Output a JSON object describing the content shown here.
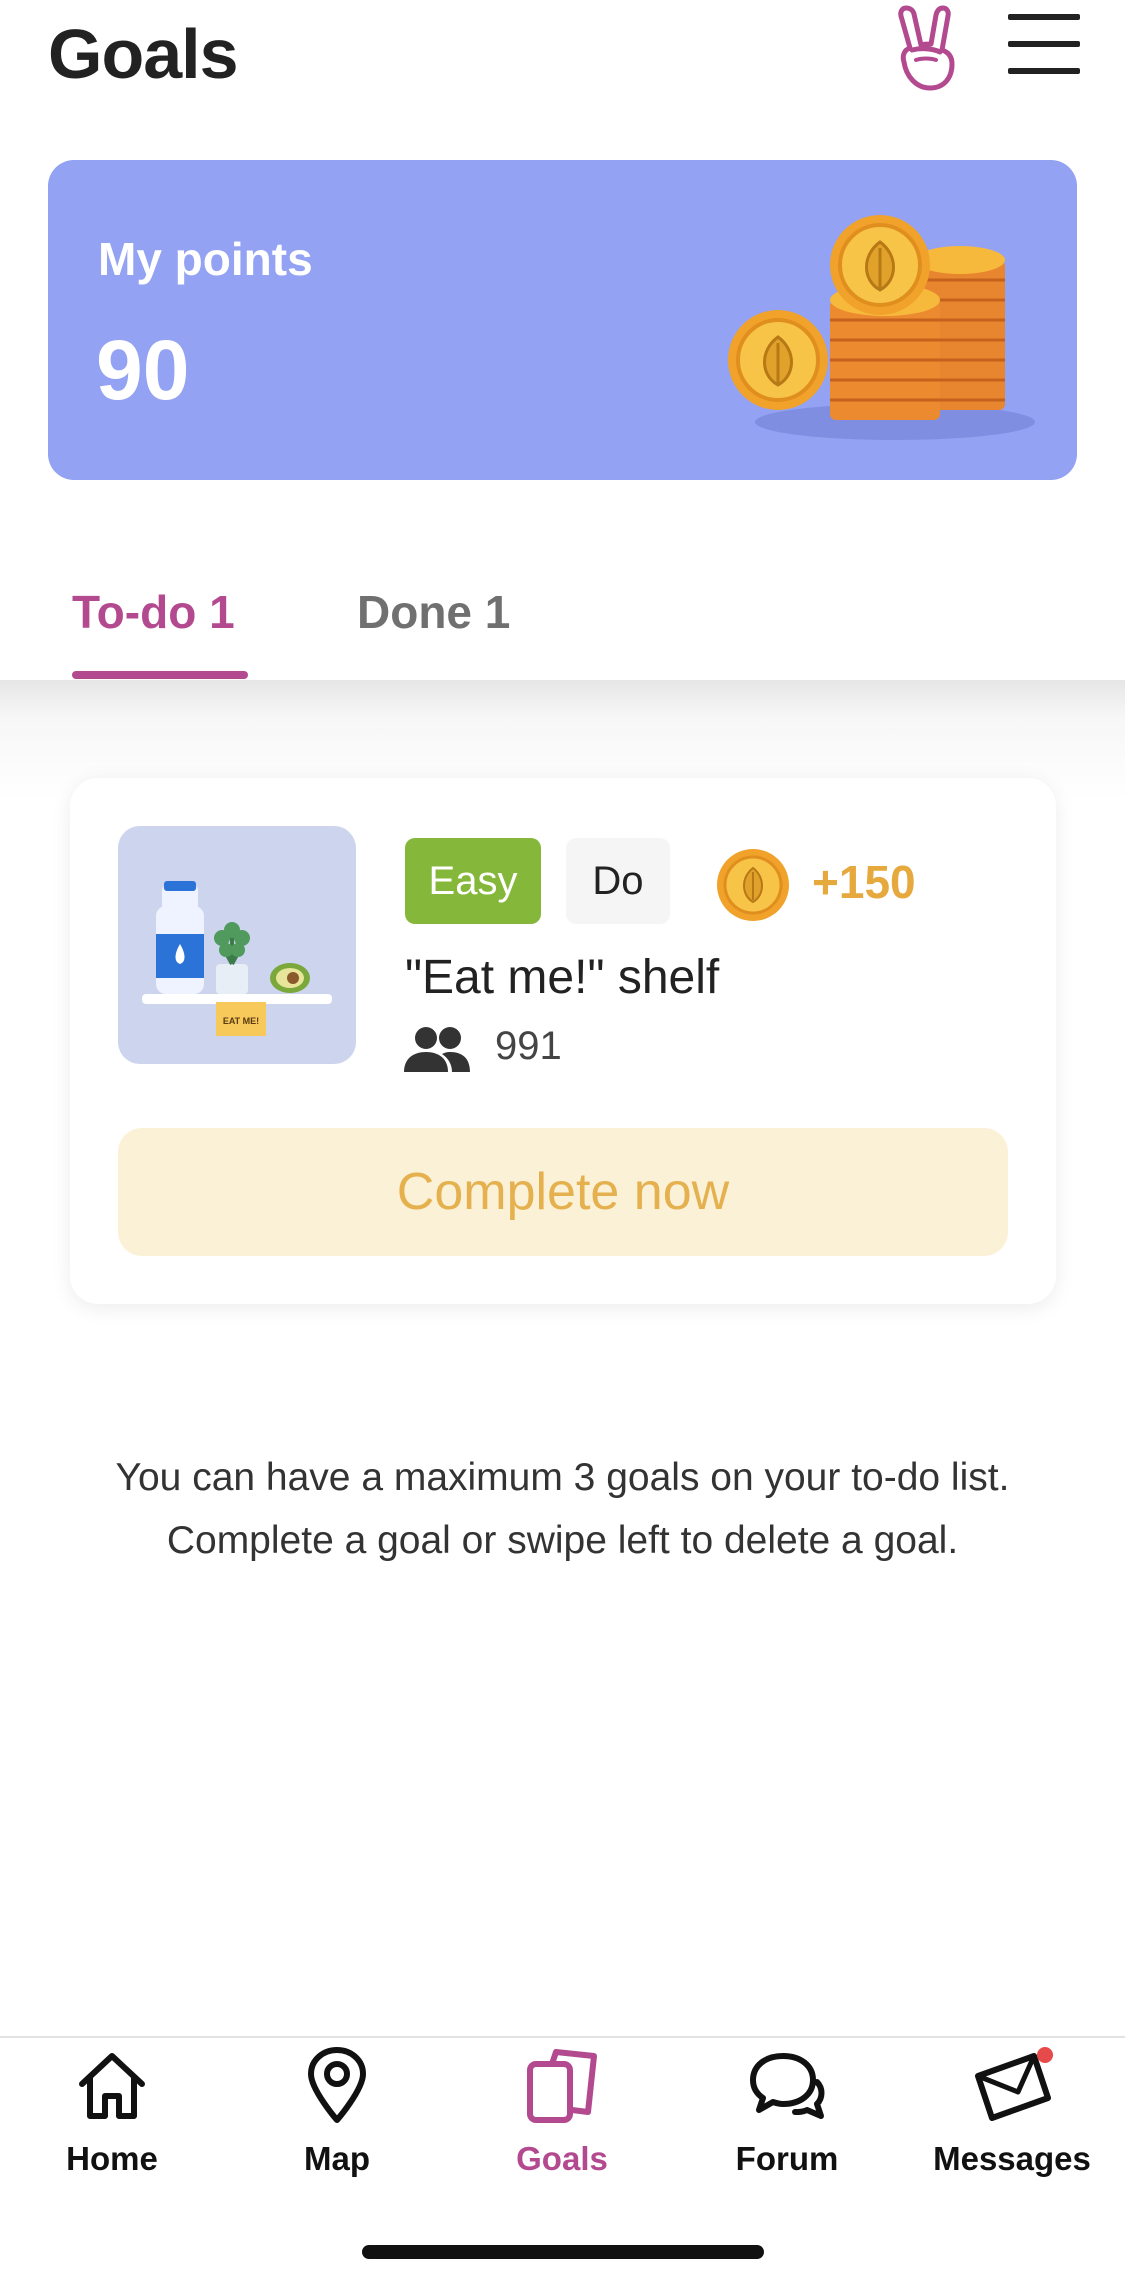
{
  "header": {
    "title": "Goals",
    "peace_icon": "peace-hand-icon",
    "menu_icon": "hamburger-menu-icon"
  },
  "points": {
    "label": "My points",
    "value": "90"
  },
  "tabs": [
    {
      "label": "To-do 1",
      "active": true
    },
    {
      "label": "Done 1",
      "active": false
    }
  ],
  "goal": {
    "difficulty": "Easy",
    "type": "Do",
    "reward": "+150",
    "title": "\"Eat me!\" shelf",
    "participants": "991",
    "image_sticker": "EAT ME!",
    "button": "Complete now"
  },
  "info": {
    "line1": "You can have a maximum 3 goals on your to-do list.",
    "line2": "Complete a goal or swipe left to delete a goal."
  },
  "nav": [
    {
      "label": "Home",
      "icon": "home-icon"
    },
    {
      "label": "Map",
      "icon": "map-pin-icon"
    },
    {
      "label": "Goals",
      "icon": "goals-cards-icon",
      "active": true
    },
    {
      "label": "Forum",
      "icon": "chat-bubbles-icon"
    },
    {
      "label": "Messages",
      "icon": "envelope-icon",
      "notification": true
    }
  ],
  "colors": {
    "accent": "#b34a8f",
    "points_card": "#93a2f2",
    "easy_badge": "#85b83a",
    "reward": "#e5a93e",
    "complete_button_bg": "#fbf1d6",
    "notification_dot": "#e74a4a"
  }
}
